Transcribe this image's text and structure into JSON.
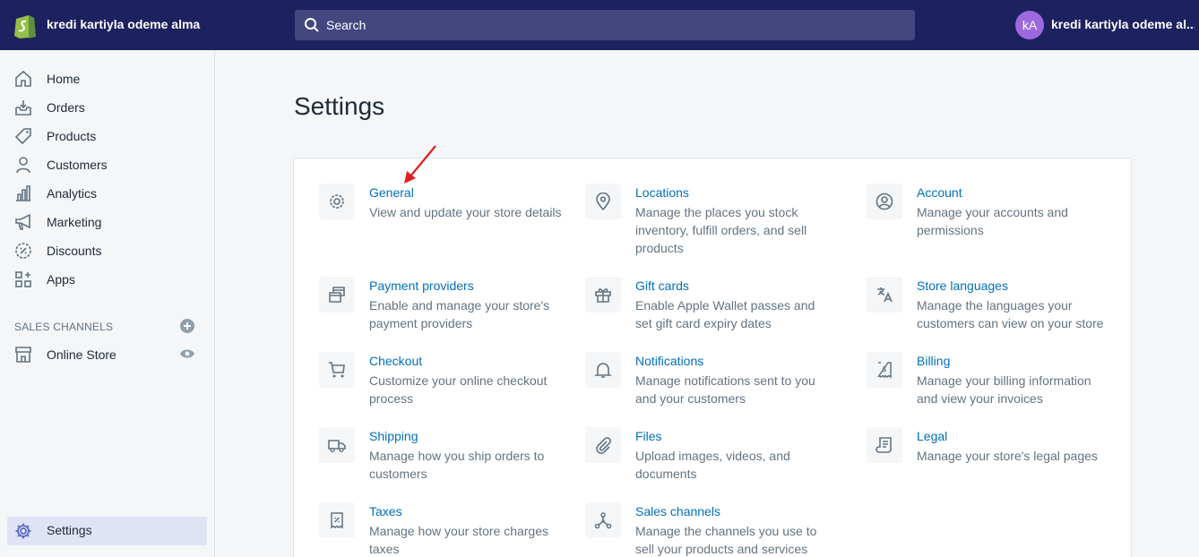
{
  "topbar": {
    "store_name": "kredi kartiyla odeme alma",
    "search_placeholder": "Search",
    "avatar_initials": "kA",
    "user_name": "kredi kartiyla odeme al..."
  },
  "sidebar": {
    "items": [
      {
        "label": "Home",
        "icon": "home-icon"
      },
      {
        "label": "Orders",
        "icon": "orders-icon"
      },
      {
        "label": "Products",
        "icon": "tag-icon"
      },
      {
        "label": "Customers",
        "icon": "person-icon"
      },
      {
        "label": "Analytics",
        "icon": "bar-chart-icon"
      },
      {
        "label": "Marketing",
        "icon": "megaphone-icon"
      },
      {
        "label": "Discounts",
        "icon": "discount-icon"
      },
      {
        "label": "Apps",
        "icon": "apps-icon"
      }
    ],
    "sales_channels_label": "SALES CHANNELS",
    "online_store_label": "Online Store",
    "settings_label": "Settings"
  },
  "main": {
    "title": "Settings",
    "tiles": [
      {
        "title": "General",
        "desc": "View and update your store details",
        "icon": "gear-icon"
      },
      {
        "title": "Locations",
        "desc": "Manage the places you stock inventory, fulfill orders, and sell products",
        "icon": "location-pin-icon"
      },
      {
        "title": "Account",
        "desc": "Manage your accounts and permissions",
        "icon": "account-icon"
      },
      {
        "title": "Payment providers",
        "desc": "Enable and manage your store's payment providers",
        "icon": "payment-icon"
      },
      {
        "title": "Gift cards",
        "desc": "Enable Apple Wallet passes and set gift card expiry dates",
        "icon": "gift-icon"
      },
      {
        "title": "Store languages",
        "desc": "Manage the languages your customers can view on your store",
        "icon": "translate-icon"
      },
      {
        "title": "Checkout",
        "desc": "Customize your online checkout process",
        "icon": "cart-icon"
      },
      {
        "title": "Notifications",
        "desc": "Manage notifications sent to you and your customers",
        "icon": "bell-icon"
      },
      {
        "title": "Billing",
        "desc": "Manage your billing information and view your invoices",
        "icon": "billing-icon"
      },
      {
        "title": "Shipping",
        "desc": "Manage how you ship orders to customers",
        "icon": "truck-icon"
      },
      {
        "title": "Files",
        "desc": "Upload images, videos, and documents",
        "icon": "paperclip-icon"
      },
      {
        "title": "Legal",
        "desc": "Manage your store's legal pages",
        "icon": "legal-icon"
      },
      {
        "title": "Taxes",
        "desc": "Manage how your store charges taxes",
        "icon": "receipt-icon"
      },
      {
        "title": "Sales channels",
        "desc": "Manage the channels you use to sell your products and services",
        "icon": "channels-icon"
      }
    ]
  },
  "colors": {
    "topbar": "#1c2260",
    "link": "#006fbb",
    "avatar": "#9c6ade",
    "arrow": "#e02020"
  }
}
